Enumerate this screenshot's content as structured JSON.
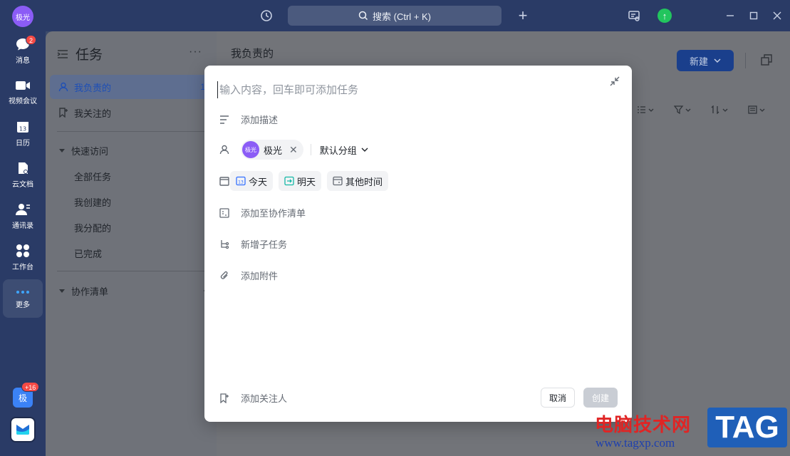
{
  "titlebar": {
    "avatar_text": "极光",
    "search_label": "搜索 (Ctrl + K)"
  },
  "nav": {
    "items": [
      {
        "label": "消息",
        "badge": "2"
      },
      {
        "label": "视频会议"
      },
      {
        "label": "日历"
      },
      {
        "label": "云文档"
      },
      {
        "label": "通讯录"
      },
      {
        "label": "工作台"
      },
      {
        "label": "更多"
      }
    ],
    "app_ji_text": "极",
    "app_ji_badge": "+16"
  },
  "tasks_sidebar": {
    "title": "任务",
    "more": "···",
    "mine": {
      "label": "我负责的",
      "count": "1"
    },
    "followed": "我关注的",
    "quick_access": "快速访问",
    "sub_items": [
      "全部任务",
      "我创建的",
      "我分配的",
      "已完成"
    ],
    "collab_list": "协作清单"
  },
  "main": {
    "title": "我负责的",
    "new_button": "新建"
  },
  "modal": {
    "input_placeholder": "输入内容，回车即可添加任务",
    "add_description": "添加描述",
    "assignee_avatar": "极光",
    "assignee_name": "极光",
    "group": "默认分组",
    "dates": [
      "今天",
      "明天",
      "其他时间"
    ],
    "date_icon_colors": [
      "#3370ff",
      "#14b8a6",
      "#646a73"
    ],
    "add_to_list": "添加至协作清单",
    "add_subtask": "新增子任务",
    "add_attachment": "添加附件",
    "add_follower": "添加关注人",
    "cancel": "取消",
    "create": "创建"
  },
  "watermark": {
    "cn": "电脑技术网",
    "url": "www.tagxp.com",
    "tag": "TAG"
  }
}
